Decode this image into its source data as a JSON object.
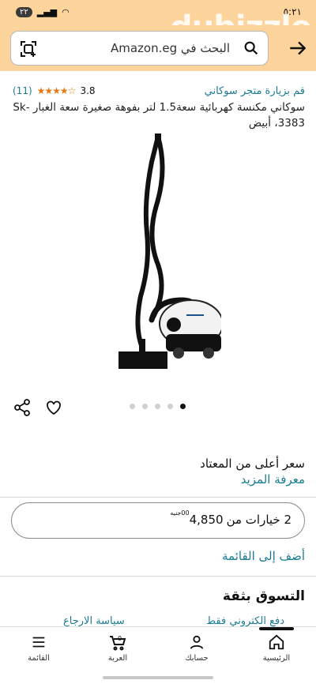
{
  "status_bar": {
    "time": "٥:٢١",
    "battery": "٢٢"
  },
  "watermark": "dubizzle",
  "search": {
    "placeholder": "البحث في Amazon.eg"
  },
  "product": {
    "store_link": "قم بزيارة متجر سوكاني",
    "rating_value": "3.8",
    "rating_count": "(11)",
    "stars": "★★★★☆",
    "title": "سوكاني مكنسة كهربائية سعة1.5 لتر بفوهة صغيرة سعة الغبار Sk-3383، أبيض"
  },
  "gallery": {
    "dot_count": 5,
    "active_index": 4
  },
  "pricing": {
    "note": "سعر أعلى من المعتاد",
    "learn_more": "معرفة المزيد"
  },
  "options": {
    "label": "2 خيارات من",
    "price": "4,850",
    "decimals": "00",
    "currency": "جنيه"
  },
  "add_to_list": "أضف إلى القائمة",
  "trust": {
    "heading": "التسوق بثقة",
    "electronic_payment": "دفع الكتروني فقط",
    "return_policy": "سياسة الارجاع"
  },
  "bottom_nav": {
    "home": "الرئيسية",
    "account": "حسابك",
    "cart": "العربة",
    "cart_count": "0",
    "menu": "القائمة"
  }
}
